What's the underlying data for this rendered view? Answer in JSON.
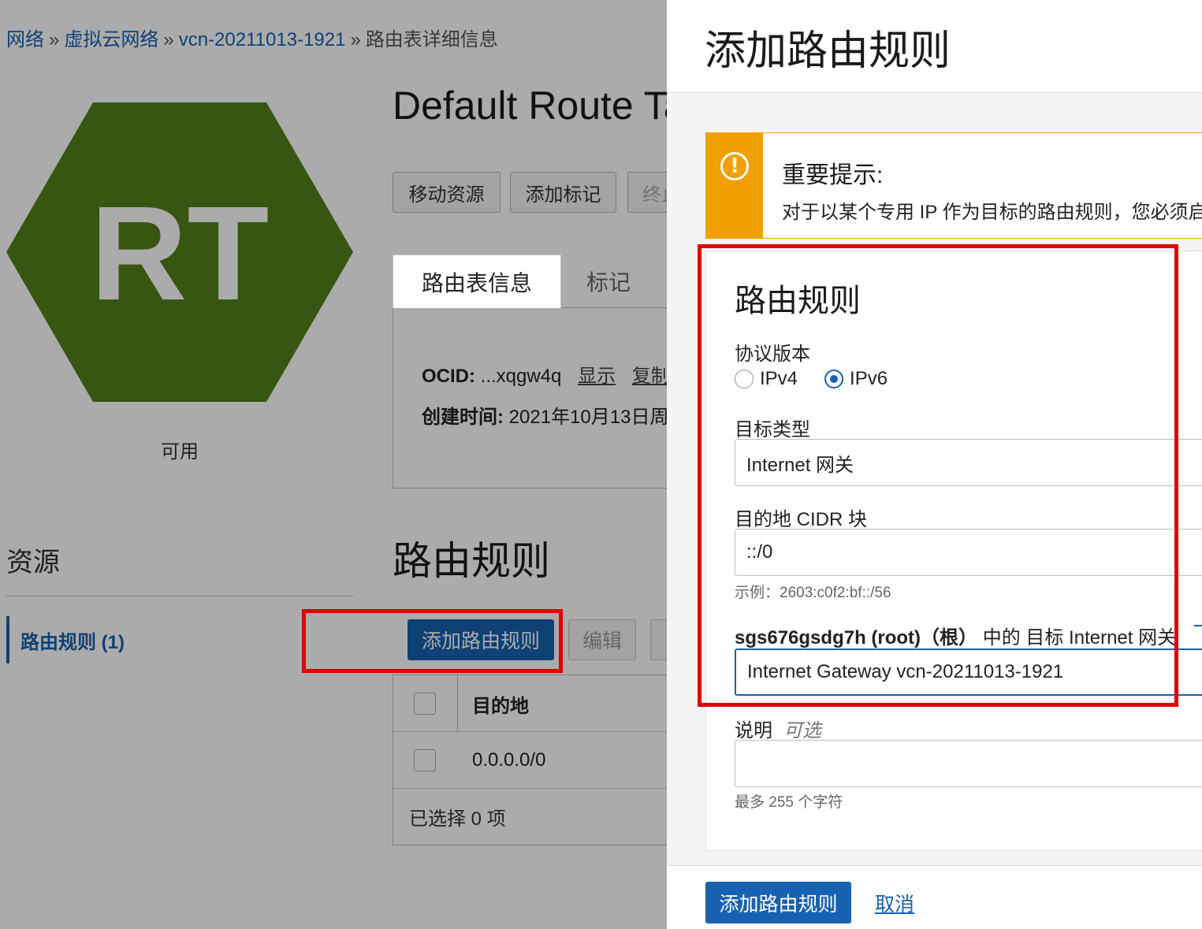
{
  "breadcrumb": {
    "items": [
      "网络",
      "虚拟云网络",
      "vcn-20211013-1921"
    ],
    "current": "路由表详细信息",
    "separator": "»"
  },
  "resource_icon": {
    "text": "RT",
    "color": "#52801a",
    "status": "可用"
  },
  "page_title": "Default Route Ta",
  "actions": {
    "move": "移动资源",
    "add_tag": "添加标记",
    "terminate": "终止"
  },
  "tabs": {
    "info": "路由表信息",
    "tags": "标记"
  },
  "info": {
    "ocid_label": "OCID:",
    "ocid_value": "...xqgw4q",
    "show_link": "显示",
    "copy_link": "复制",
    "created_label": "创建时间:",
    "created_value": "2021年10月13日周"
  },
  "resources": {
    "title": "资源",
    "item": "路由规则 (1)"
  },
  "rules_section": {
    "title": "路由规则",
    "add_button": "添加路由规则",
    "edit_button": "编辑",
    "col_destination": "目的地",
    "row_destination": "0.0.0.0/0",
    "selected_text": "已选择 0 项"
  },
  "drawer": {
    "title": "添加路由规则",
    "notice": {
      "title": "重要提示:",
      "text": "对于以某个专用 IP 作为目标的路由规则，您必须启"
    },
    "form": {
      "heading": "路由规则",
      "protocol_label": "协议版本",
      "protocol_options": [
        "IPv4",
        "IPv6"
      ],
      "protocol_selected": "IPv6",
      "target_type_label": "目标类型",
      "target_type_value": "Internet 网关",
      "cidr_label": "目的地 CIDR 块",
      "cidr_value": "::/0",
      "cidr_hint": "示例：2603:c0f2:bf::/56",
      "gateway_compartment": "sgs676gsdg7h (root)（根）",
      "gateway_label_suffix": " 中的 目标 Internet 网关",
      "gateway_value": "Internet Gateway vcn-20211013-1921",
      "description_label": "说明",
      "description_optional": "可选",
      "description_value": "",
      "description_hint": "最多 255 个字符"
    },
    "submit_button": "添加路由规则",
    "cancel_link": "取消"
  },
  "colors": {
    "primary": "#1762b0",
    "warning": "#f0a000",
    "highlight": "#e00000",
    "icon_green": "#52801a"
  }
}
